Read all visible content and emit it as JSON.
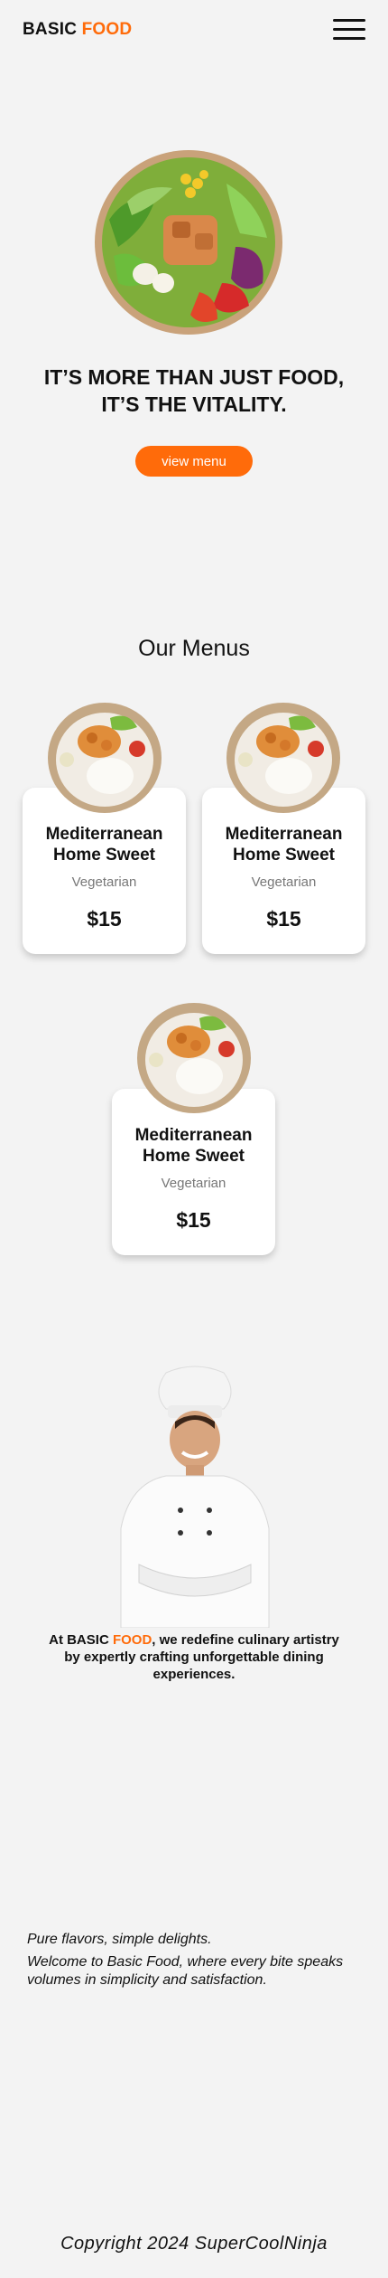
{
  "header": {
    "logo_primary": "BASIC",
    "logo_accent": "FOOD",
    "menu_icon": "hamburger-menu-icon"
  },
  "hero": {
    "title_line1": "IT’S MORE THAN JUST FOOD,",
    "title_line2": "IT’S THE VITALITY.",
    "cta_label": "view menu",
    "image": "salad-bowl-image"
  },
  "menus": {
    "title": "Our Menus",
    "items": [
      {
        "name_line1": "Mediterranean",
        "name_line2": "Home Sweet",
        "category": "Vegetarian",
        "price": "$15"
      },
      {
        "name_line1": "Mediterranean",
        "name_line2": "Home Sweet",
        "category": "Vegetarian",
        "price": "$15"
      },
      {
        "name_line1": "Mediterranean",
        "name_line2": "Home Sweet",
        "category": "Vegetarian",
        "price": "$15"
      }
    ]
  },
  "about": {
    "prefix": "At BASIC ",
    "accent": "FOOD",
    "suffix": ", we redefine culinary artistry by expertly crafting unforgettable dining experiences.",
    "image": "chef-image"
  },
  "tagline": {
    "headline": "Pure flavors, simple delights.",
    "body": "Welcome to Basic Food, where every bite speaks volumes in simplicity and satisfaction."
  },
  "footer": {
    "copyright": "Copyright 2024 SuperCoolNinja"
  },
  "colors": {
    "accent": "#ff6b0a",
    "background": "#f3f3f3",
    "card": "#ffffff"
  }
}
